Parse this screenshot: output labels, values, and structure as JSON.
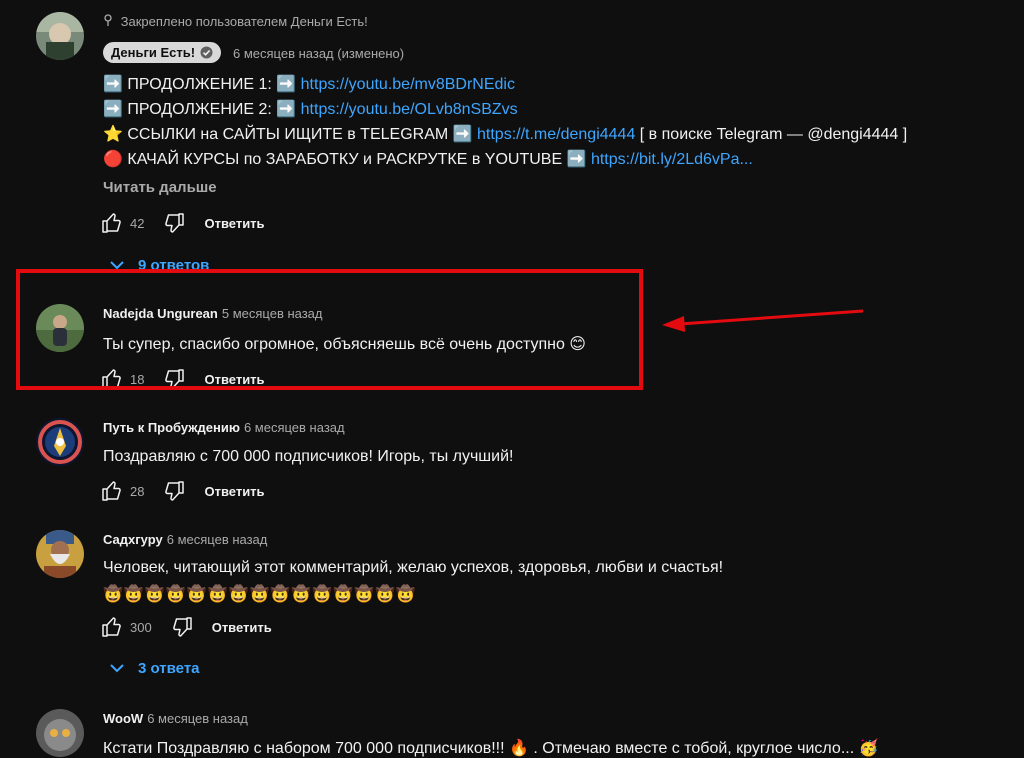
{
  "pinned_comment": {
    "pinned_note": "Закреплено пользователем Деньги Есть!",
    "author_badge": "Деньги Есть!",
    "time": "6 месяцев назад (изменено)",
    "lines": [
      {
        "prefix": "➡️ ПРОДОЛЖЕНИЕ 1: ➡️ ",
        "link": "https://youtu.be/mv8BDrNEdic",
        "suffix": ""
      },
      {
        "prefix": "➡️ ПРОДОЛЖЕНИЕ 2: ➡️ ",
        "link": "https://youtu.be/OLvb8nSBZvs",
        "suffix": ""
      },
      {
        "prefix": "⭐ ССЫЛКИ на САЙТЫ ИЩИТЕ в TELEGRAM ➡️ ",
        "link": "https://t.me/dengi4444",
        "suffix": " [ в поиске Telegram — @dengi4444 ]"
      },
      {
        "prefix": "🔴 КАЧАЙ КУРСЫ по ЗАРАБОТКУ и РАСКРУТКЕ в YOUTUBE ➡️ ",
        "link": "https://bit.ly/2Ld6vPa",
        "suffix": "..."
      }
    ],
    "read_more": "Читать дальше",
    "likes": "42",
    "reply_label": "Ответить",
    "replies_label": "9 ответов"
  },
  "comments": [
    {
      "author": "Nadejda Ungurean",
      "time": "5 месяцев назад",
      "text": "Ты супер, спасибо огромное, объясняешь всё очень доступно 😊",
      "likes": "18",
      "reply_label": "Ответить"
    },
    {
      "author": "Путь к Пробуждению",
      "time": "6 месяцев назад",
      "text": "Поздравляю с 700 000 подписчиков! Игорь, ты лучший!",
      "likes": "28",
      "reply_label": "Ответить"
    },
    {
      "author": "Садхгуру",
      "time": "6 месяцев назад",
      "text": "Человек, читающий этот комментарий, желаю успехов, здоровья, любви и счастья!",
      "emoji_line": "🤠🤠🤠🤠🤠🤠🤠🤠🤠🤠🤠🤠🤠🤠🤠",
      "likes": "300",
      "reply_label": "Ответить",
      "replies_label": "3 ответа"
    },
    {
      "author": "WooW",
      "time": "6 месяцев назад",
      "text": "Кстати Поздравляю с набором 700 000 подписчиков!!! 🔥 . Отмечаю вместе с тобой, круглое число... 🥳"
    }
  ],
  "colors": {
    "background": "#0f0f0f",
    "link": "#3ea6ff",
    "highlight": "#e40b10",
    "muted": "#aaaaaa"
  }
}
